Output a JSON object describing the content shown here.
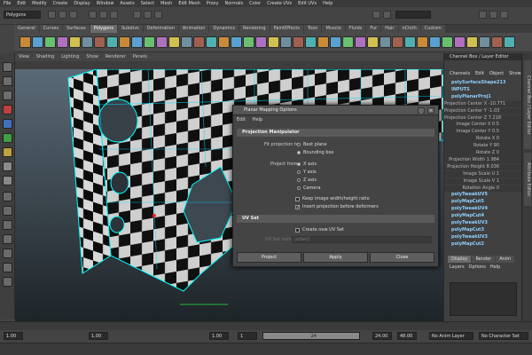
{
  "menubar": {
    "items": [
      "File",
      "Edit",
      "Modify",
      "Create",
      "Display",
      "Window",
      "Assets",
      "Select",
      "Mesh",
      "Edit Mesh",
      "Proxy",
      "Normals",
      "Color",
      "Create UVs",
      "Edit UVs",
      "Help"
    ]
  },
  "status": {
    "mode": "Polygons"
  },
  "shelf": {
    "tabs": [
      "General",
      "Curves",
      "Surfaces",
      "Polygons",
      "Subdivs",
      "Deformation",
      "Animation",
      "Dynamics",
      "Rendering",
      "PaintEffects",
      "Toon",
      "Muscle",
      "Fluids",
      "Fur",
      "Hair",
      "nCloth",
      "Custom"
    ],
    "active_tab": "Polygons"
  },
  "viewport": {
    "menu": [
      "View",
      "Shading",
      "Lighting",
      "Show",
      "Renderer",
      "Panels"
    ]
  },
  "channel_box": {
    "header": "Channel Box / Layer Editor",
    "menu": [
      "Channels",
      "Edit",
      "Object",
      "Show"
    ],
    "rows": [
      {
        "text": "polySurfaceShape213",
        "type": "node"
      },
      {
        "text": "INPUTS",
        "type": "node"
      },
      {
        "text": "polyPlanarProj1",
        "type": "node"
      },
      {
        "text": "Projection Center X -10.771",
        "type": "row"
      },
      {
        "text": "Projection Center Y -1.03",
        "type": "row"
      },
      {
        "text": "Projection Center Z 7.218",
        "type": "row"
      },
      {
        "text": "Image Center X 0.5",
        "type": "row"
      },
      {
        "text": "Image Center Y 0.5",
        "type": "row"
      },
      {
        "text": "Rotate X 0",
        "type": "row"
      },
      {
        "text": "Rotate Y 90",
        "type": "row"
      },
      {
        "text": "Rotate Z 0",
        "type": "row"
      },
      {
        "text": "Projection Width 1.984",
        "type": "row"
      },
      {
        "text": "Projection Height 8.036",
        "type": "row"
      },
      {
        "text": "Image Scale U 1",
        "type": "row"
      },
      {
        "text": "Image Scale V 1",
        "type": "row"
      },
      {
        "text": "Rotation Angle 0",
        "type": "row"
      },
      {
        "text": "polyTweakUV5",
        "type": "node"
      },
      {
        "text": "polyMapCut5",
        "type": "node"
      },
      {
        "text": "polyTweakUV4",
        "type": "node"
      },
      {
        "text": "polyMapCut4",
        "type": "node"
      },
      {
        "text": "polyTweakUV3",
        "type": "node"
      },
      {
        "text": "polyMapCut3",
        "type": "node"
      },
      {
        "text": "polyTweakUV3",
        "type": "node"
      },
      {
        "text": "polyMapCut2",
        "type": "node"
      }
    ],
    "layer_tabs": [
      "Display",
      "Render",
      "Anim"
    ],
    "layer_menu": [
      "Layers",
      "Options",
      "Help"
    ]
  },
  "side_tabs": [
    "Channel Box / Layer Editor",
    "Attribute Editor"
  ],
  "dialog": {
    "title": "Planar Mapping Options",
    "menu": [
      "Edit",
      "Help"
    ],
    "section_projection": "Projection Manipulator",
    "fit_label": "Fit projection to:",
    "fit_options": [
      "Best plane",
      "Bounding box"
    ],
    "from_label": "Project from:",
    "from_options": [
      "X axis",
      "Y axis",
      "Z axis",
      "Camera"
    ],
    "keep_ratio": "Keep image width/height ratio",
    "insert_before": "Insert projection before deformers",
    "section_uv": "UV Set",
    "create_uv": "Create new UV Set",
    "uv_label": "UV Set name",
    "uv_value": "uvSet1",
    "buttons": [
      "Project",
      "Apply",
      "Close"
    ]
  },
  "range": {
    "start": "1.00",
    "start2": "1.00",
    "current": "1",
    "end_marker": "24",
    "end": "24.00",
    "end2": "48.00",
    "anim_layer": "No Anim Layer",
    "character": "No Character Set",
    "frame": "1.00"
  },
  "colors": {
    "accent": "#00ffff",
    "selected_tab": "#6b6b6b"
  }
}
